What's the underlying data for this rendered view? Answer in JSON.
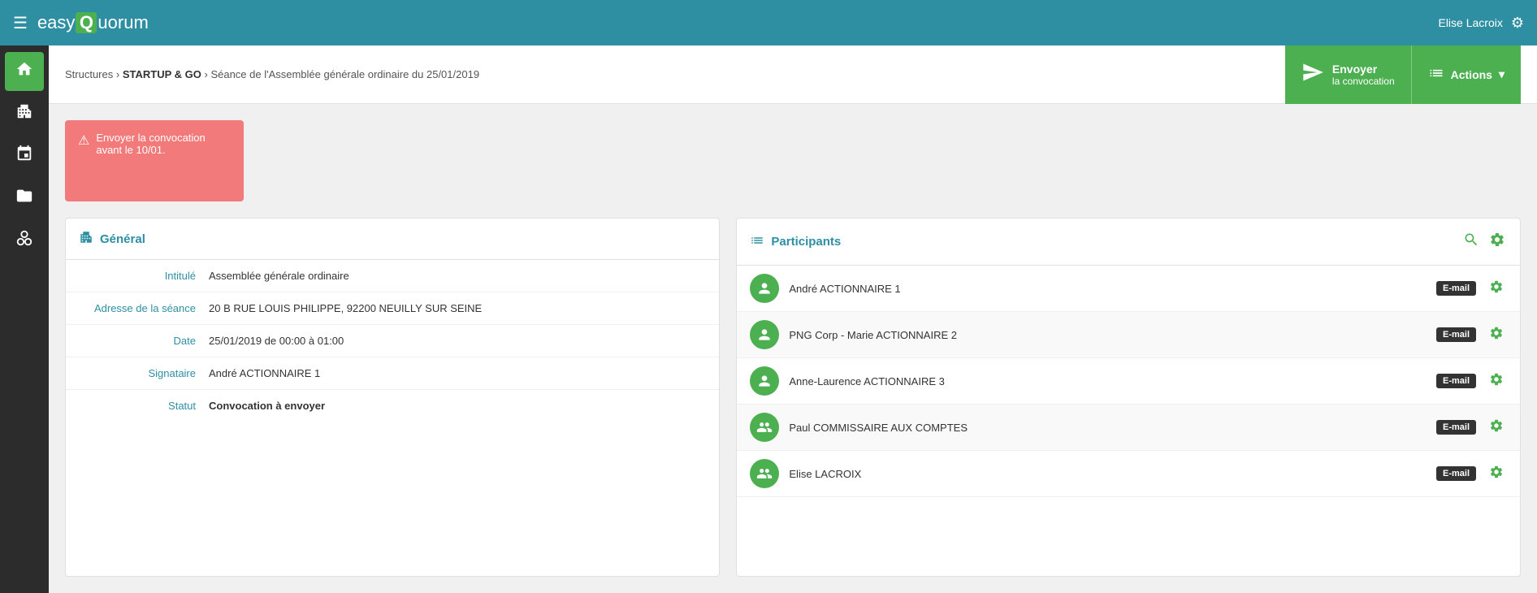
{
  "topNav": {
    "hamburger": "☰",
    "logoEasy": "easy",
    "logoQ": "Q",
    "logoRest": "uorum",
    "user": "Elise Lacroix",
    "gearIcon": "⚙"
  },
  "sidebar": {
    "items": [
      {
        "id": "home",
        "icon": "⌂",
        "active": true
      },
      {
        "id": "building",
        "icon": "▦",
        "active": false
      },
      {
        "id": "calendar",
        "icon": "▦",
        "active": false
      },
      {
        "id": "folder",
        "icon": "▤",
        "active": false
      },
      {
        "id": "network",
        "icon": "⌾",
        "active": false
      }
    ]
  },
  "breadcrumb": {
    "text": "Structures",
    "separator1": "›",
    "startup": "STARTUP & GO",
    "separator2": "›",
    "seance": "Séance de l'Assemblée générale ordinaire du 25/01/2019"
  },
  "actions": {
    "envoyerLabel": "Envoyer",
    "envoyerSub": "la convocation",
    "actionsLabel": "Actions",
    "dropdownIcon": "▾",
    "listIcon": "☰",
    "sendIcon": "✈"
  },
  "alert": {
    "icon": "⚠",
    "text": "Envoyer la convocation avant le 10/01."
  },
  "general": {
    "title": "Général",
    "icon": "▦",
    "rows": [
      {
        "label": "Intitulé",
        "value": "Assemblée générale ordinaire",
        "bold": false
      },
      {
        "label": "Adresse de la séance",
        "value": "20 B RUE LOUIS PHILIPPE, 92200 NEUILLY SUR SEINE",
        "bold": false
      },
      {
        "label": "Date",
        "value": "25/01/2019 de 00:00 à 01:00",
        "bold": false
      },
      {
        "label": "Signataire",
        "value": "André ACTIONNAIRE 1",
        "bold": false
      },
      {
        "label": "Statut",
        "value": "Convocation à envoyer",
        "bold": true
      }
    ]
  },
  "participants": {
    "title": "Participants",
    "icon": "☰",
    "searchIcon": "🔍",
    "gearIcon": "⚙",
    "list": [
      {
        "name": "André ACTIONNAIRE 1",
        "badge": "E-mail",
        "avatarIcon": "👤"
      },
      {
        "name": "PNG Corp - Marie ACTIONNAIRE 2",
        "badge": "E-mail",
        "avatarIcon": "👤"
      },
      {
        "name": "Anne-Laurence ACTIONNAIRE 3",
        "badge": "E-mail",
        "avatarIcon": "👤"
      },
      {
        "name": "Paul COMMISSAIRE AUX COMPTES",
        "badge": "E-mail",
        "avatarIcon": "👤"
      },
      {
        "name": "Elise LACROIX",
        "badge": "E-mail",
        "avatarIcon": "👤"
      }
    ]
  }
}
